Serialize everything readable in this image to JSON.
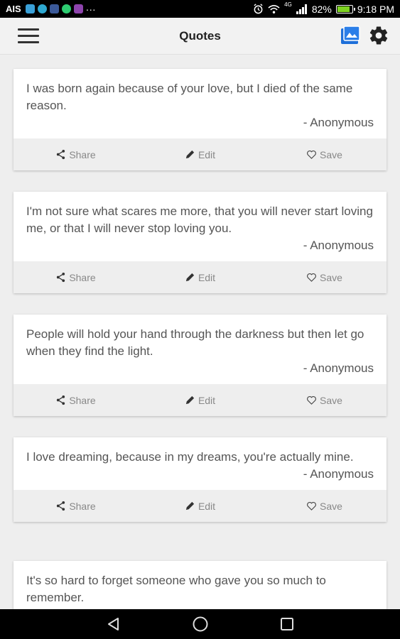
{
  "status_bar": {
    "carrier": "AIS",
    "signal_label": "4G",
    "battery": "82%",
    "time": "9:18 PM",
    "more": "···"
  },
  "app_bar": {
    "title": "Quotes"
  },
  "colors": {
    "accent_blue": "#1e6fd9",
    "text": "#555555",
    "action_text": "#888888"
  },
  "actions": {
    "share": "Share",
    "edit": "Edit",
    "save": "Save"
  },
  "quotes": [
    {
      "text": "I was born again because of your love, but I died of the same reason.",
      "author": "- Anonymous"
    },
    {
      "text": "I'm not sure what scares me more, that you will never start loving me, or that I will never stop loving you.",
      "author": "- Anonymous"
    },
    {
      "text": "People will hold your hand through the darkness but then let go when they find the light.",
      "author": "- Anonymous"
    },
    {
      "text": "I love dreaming, because in my dreams, you're actually mine.",
      "author": "- Anonymous"
    },
    {
      "text": "It's so hard to forget someone who gave you so much to remember.",
      "author": ""
    }
  ]
}
